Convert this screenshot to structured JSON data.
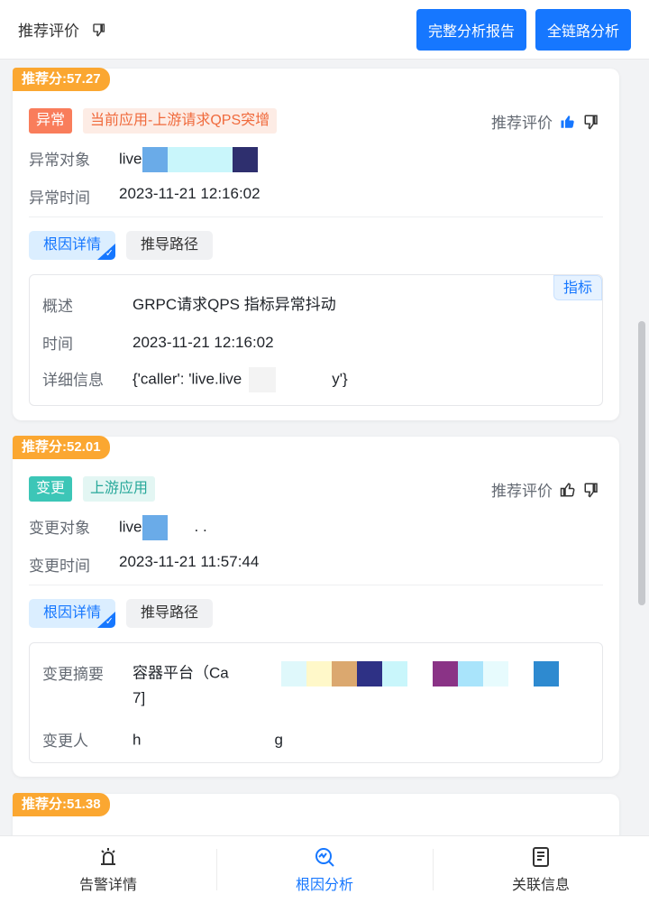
{
  "header": {
    "title": "推荐评价",
    "btn_report": "完整分析报告",
    "btn_chain": "全链路分析"
  },
  "cards": [
    {
      "score": "推荐分:57.27",
      "tag_type": "异常",
      "tag_desc": "当前应用-上游请求QPS突增",
      "eval_label": "推荐评价",
      "obj_label": "异常对象",
      "obj_value": "live",
      "time_label": "异常时间",
      "time_value": "2023-11-21 12:16:02",
      "tab_root": "根因详情",
      "tab_path": "推导路径",
      "metric_tag": "指标",
      "detail": [
        {
          "k": "概述",
          "v": "GRPC请求QPS 指标异常抖动"
        },
        {
          "k": "时间",
          "v": "2023-11-21 12:16:02"
        },
        {
          "k": "详细信息",
          "v": "{'caller': 'live.live",
          "v2": "y'}"
        }
      ]
    },
    {
      "score": "推荐分:52.01",
      "tag_type": "变更",
      "tag_desc": "上游应用",
      "eval_label": "推荐评价",
      "obj_label": "变更对象",
      "obj_value": "live",
      "obj_suffix": ". .",
      "time_label": "变更时间",
      "time_value": "2023-11-21 11:57:44",
      "tab_root": "根因详情",
      "tab_path": "推导路径",
      "detail": [
        {
          "k": "变更摘要",
          "v": "容器平台（Ca",
          "v_line2": "7]"
        },
        {
          "k": "变更人",
          "v": "h",
          "v2": "g"
        }
      ]
    },
    {
      "score": "推荐分:51.38"
    }
  ],
  "nav": {
    "alert": "告警详情",
    "root": "根因分析",
    "related": "关联信息"
  },
  "colors": {
    "primary": "#1677ff",
    "score": "#fba731",
    "anomaly": "#f97d5b",
    "change": "#3cc6b7"
  }
}
